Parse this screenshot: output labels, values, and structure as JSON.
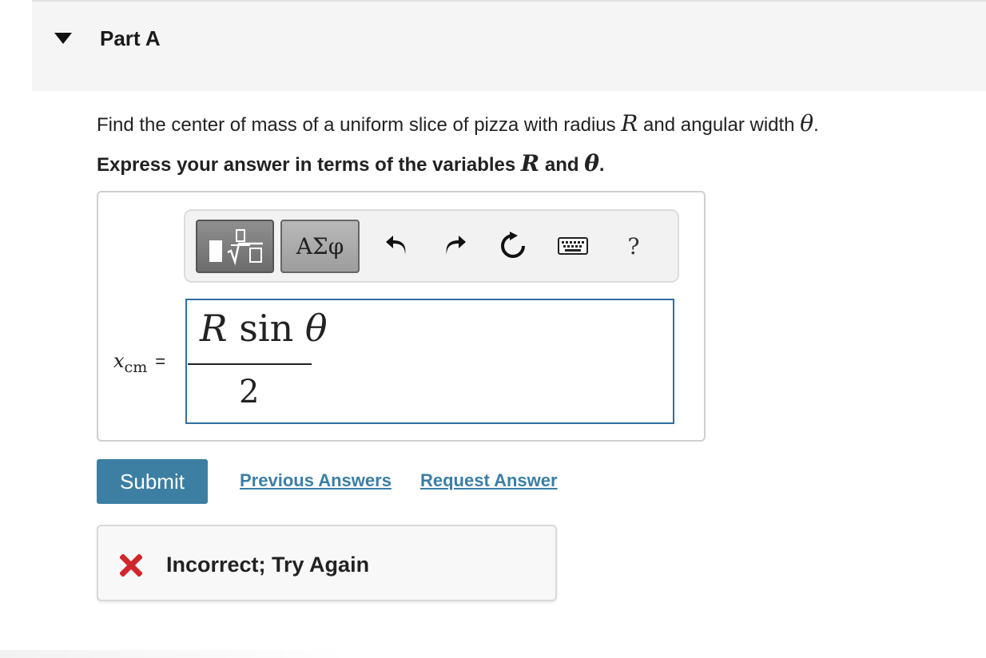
{
  "part": {
    "title": "Part A"
  },
  "question": {
    "text_1": "Find the center of mass of a uniform slice of pizza with radius ",
    "var_r": "R",
    "text_2": " and angular width ",
    "var_theta": "θ",
    "text_3": "."
  },
  "instruction": {
    "text_1": "Express your answer in terms of the variables ",
    "var_r": "R",
    "text_2": " and ",
    "var_theta": "θ",
    "text_3": "."
  },
  "toolbar": {
    "template_icon": "fraction-sqrt-template-icon",
    "greek_label": "ΑΣφ",
    "undo_icon": "undo-icon",
    "redo_icon": "redo-icon",
    "reset_icon": "reset-icon",
    "keyboard_icon": "keyboard-icon",
    "help_label": "?"
  },
  "answer": {
    "variable": "x",
    "subscript": "cm",
    "equals": "=",
    "numerator": "R sin θ",
    "denominator": "2"
  },
  "actions": {
    "submit_label": "Submit",
    "previous_answers_label": "Previous Answers",
    "request_answer_label": "Request Answer"
  },
  "feedback": {
    "icon": "x-mark-icon",
    "message": "Incorrect; Try Again",
    "icon_color": "#d0272d"
  },
  "colors": {
    "submit_bg": "#3d7fa3",
    "link": "#3a7ea6",
    "input_border": "#2f6fa3"
  }
}
